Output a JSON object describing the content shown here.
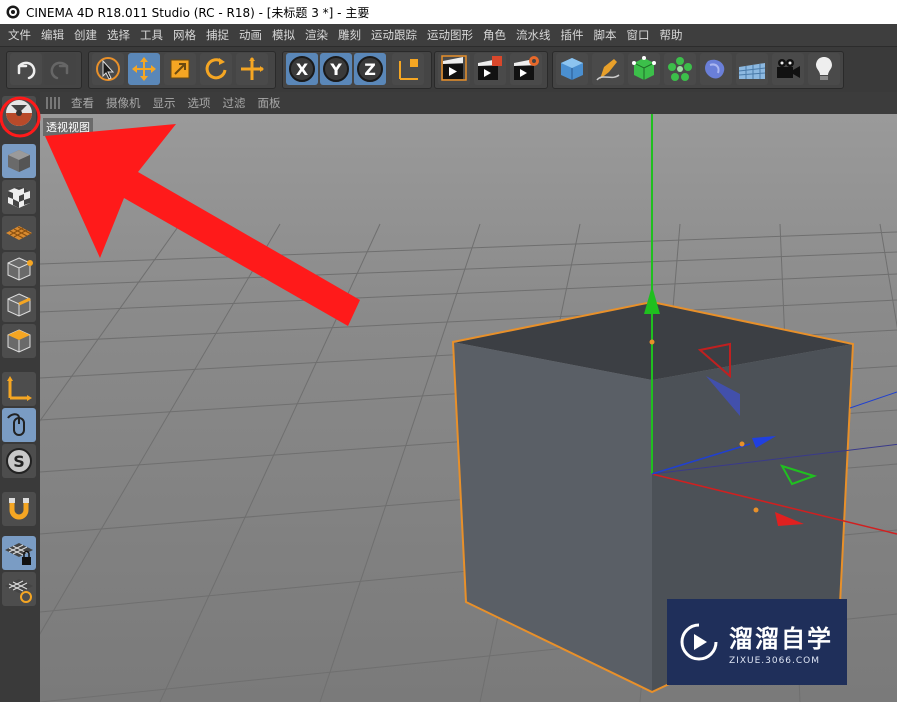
{
  "window": {
    "title": "CINEMA 4D R18.011 Studio (RC - R18) - [未标题 3 *] - 主要"
  },
  "menubar": {
    "items": [
      "文件",
      "编辑",
      "创建",
      "选择",
      "工具",
      "网格",
      "捕捉",
      "动画",
      "模拟",
      "渲染",
      "雕刻",
      "运动跟踪",
      "运动图形",
      "角色",
      "流水线",
      "插件",
      "脚本",
      "窗口",
      "帮助"
    ]
  },
  "toolbar": {
    "buttons": [
      "undo-icon",
      "redo-icon",
      "live-selection-icon",
      "move-icon",
      "scale-icon",
      "rotate-icon",
      "last-tool-icon",
      "x-axis-icon",
      "y-axis-icon",
      "z-axis-icon",
      "coordinate-system-icon",
      "render-view-icon",
      "render-to-picture-viewer-icon",
      "render-settings-icon",
      "cube-icon",
      "pen-icon",
      "subdivision-icon",
      "array-icon",
      "deformer-icon",
      "floor-icon",
      "camera-icon",
      "light-icon"
    ],
    "axis_letters": [
      "X",
      "Y",
      "Z"
    ]
  },
  "leftbar": {
    "buttons": [
      "view-mode-icon",
      "model-mode-icon",
      "texture-mode-icon",
      "workplane-icon",
      "points-mode-icon",
      "edges-mode-icon",
      "polygons-mode-icon",
      "axis-mode-icon",
      "tweak-mode-icon",
      "solo-mode-icon",
      "snap-icon",
      "lock-workplane-icon",
      "workplane-align-icon"
    ],
    "solo_letter": "S"
  },
  "viewport": {
    "menu": [
      "查看",
      "摄像机",
      "显示",
      "选项",
      "过滤",
      "面板"
    ],
    "label": "透视视图"
  },
  "watermark": {
    "title": "溜溜自学",
    "url": "ZIXUE.3066.COM"
  },
  "colors": {
    "accent_blue": "#5a87b8",
    "annotation_red": "#ff1a1a",
    "selection_orange": "#e8902a",
    "axis_x": "#e02020",
    "axis_y": "#20c020",
    "axis_z": "#2040e0"
  }
}
